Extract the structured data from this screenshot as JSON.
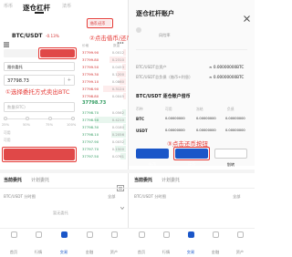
{
  "left": {
    "top_tabs": {
      "spot": "币币",
      "margin": "逐仓杠杆",
      "fiat": "法币"
    },
    "pair_label": "BTC/USDT",
    "pair_badge": "5X",
    "change": "-0.13%",
    "borrow_repay_btn": "借币/还币",
    "buy_tab": "买入",
    "sell_tab": "卖出",
    "order_type": "限价委托",
    "price_value": "37798.73",
    "amount_placeholder": "数量(BTC)",
    "percents": [
      "25%",
      "50%",
      "75%",
      "100%"
    ],
    "avail_label": "可用",
    "sell_button": "卖出(借币)BTC",
    "orderbook_header": {
      "price": "价格",
      "qty": "数量"
    },
    "asks": [
      {
        "p": "37799.90",
        "q": "0.0012"
      },
      {
        "p": "37799.80",
        "q": "0.2310"
      },
      {
        "p": "37799.50",
        "q": "0.0453"
      },
      {
        "p": "37799.30",
        "q": "0.1200"
      },
      {
        "p": "37799.10",
        "q": "0.0860"
      },
      {
        "p": "37798.90",
        "q": "0.3124"
      },
      {
        "p": "37798.80",
        "q": "0.0045"
      }
    ],
    "last_price": "37798.73",
    "bids": [
      {
        "p": "37798.70",
        "q": "0.0562"
      },
      {
        "p": "37798.50",
        "q": "0.4210"
      },
      {
        "p": "37798.30",
        "q": "0.0180"
      },
      {
        "p": "37798.10",
        "q": "0.2056"
      },
      {
        "p": "37797.90",
        "q": "0.0032"
      },
      {
        "p": "37797.70",
        "q": "0.1500"
      },
      {
        "p": "37797.50",
        "q": "0.0761"
      }
    ],
    "order_tabs": {
      "current": "当前委托",
      "plan": "计划委托"
    },
    "order_sub": "BTC/USDT 分时图",
    "all_filter": "全部",
    "empty_hint": "暂无委托",
    "nav": [
      "首页",
      "行情",
      "交易",
      "金融",
      "资产"
    ]
  },
  "annotations": {
    "a2": "②点击借币/还币",
    "a1": "①选择委托方式卖出BTC",
    "a3": "③点击还币按钮"
  },
  "right": {
    "title": "逐仓杠杆账户",
    "status_label": "风险率",
    "pair_header": "BTC/USDT 全部资产",
    "asset_rows": [
      {
        "label": "BTC/USDT总资产",
        "value": "≈ 0.00000000BTC"
      },
      {
        "label": "BTC/USDT总负债（借币+利息）",
        "value": "≈ 0.00000000BTC"
      }
    ],
    "sub_section": "BTC/USDT 逐仓账户借币",
    "columns": [
      "币种",
      "可用",
      "冻结",
      "负债"
    ],
    "coins": [
      {
        "name": "BTC",
        "vals": [
          "0.00000000",
          "0.00000000",
          "0.00000000"
        ]
      },
      {
        "name": "USDT",
        "vals": [
          "0.00000000",
          "0.00000000",
          "0.00000000"
        ]
      }
    ],
    "btn_borrow": "借币",
    "btn_repay": "还币",
    "btn_transfer": "划转",
    "orders_tabs": {
      "current": "当前委托",
      "plan": "计划委托"
    },
    "order_sub": "BTC/USDT 分时图",
    "all_filter": "全部",
    "nav": [
      "首页",
      "行情",
      "交易",
      "金融",
      "资产"
    ]
  },
  "colors": {
    "sell": "#e04848",
    "buy": "#2e9a5e",
    "annotation": "#e53935",
    "primary": "#1a56c8"
  }
}
